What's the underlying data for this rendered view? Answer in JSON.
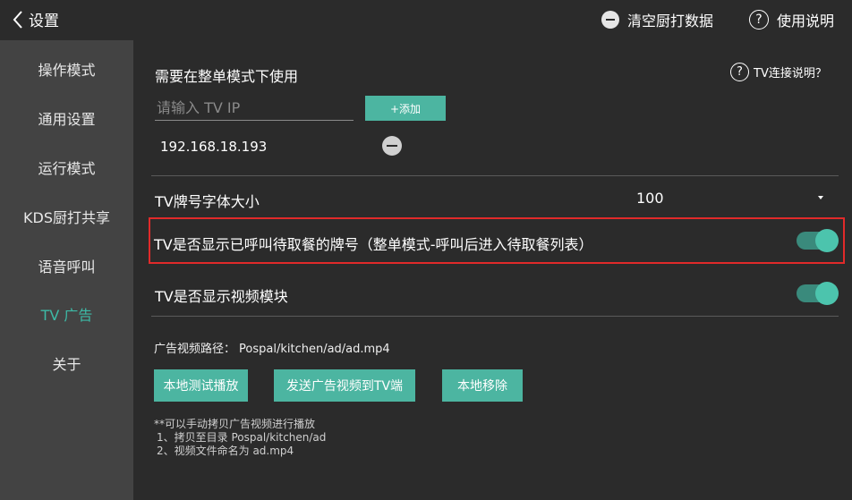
{
  "header": {
    "back_label": "设置",
    "clear_label": "清空厨打数据",
    "help_label": "使用说明"
  },
  "sidebar": {
    "items": [
      {
        "label": "操作模式"
      },
      {
        "label": "通用设置"
      },
      {
        "label": "运行模式"
      },
      {
        "label": "KDS厨打共享"
      },
      {
        "label": "语音呼叫"
      },
      {
        "label": "TV 广告",
        "active": true
      },
      {
        "label": "关于"
      }
    ]
  },
  "main": {
    "mode_note": "需要在整单模式下使用",
    "tv_help_label": "TV连接说明？",
    "ip_placeholder": "请输入 TV IP",
    "add_label": "+添加",
    "ips": [
      "192.168.18.193"
    ],
    "font_size_label": "TV牌号字体大小",
    "font_size_value": "100",
    "show_waiting_label": "TV是否显示已呼叫待取餐的牌号（整单模式-呼叫后进入待取餐列表）",
    "show_waiting_on": true,
    "show_video_label": "TV是否显示视频模块",
    "show_video_on": true,
    "video_path_label": "广告视频路径：",
    "video_path_value": "Pospal/kitchen/ad/ad.mp4",
    "btn_local_test": "本地测试播放",
    "btn_send": "发送广告视频到TV端",
    "btn_remove": "本地移除",
    "notes": [
      "**可以手动拷贝广告视频进行播放",
      "1、拷贝至目录 Pospal/kitchen/ad",
      "2、视频文件命名为 ad.mp4"
    ]
  },
  "colors": {
    "accent": "#4cb5a1",
    "sidebar_bg": "#434343",
    "content_bg": "#2b2b2b",
    "highlight": "#e12a2a"
  }
}
